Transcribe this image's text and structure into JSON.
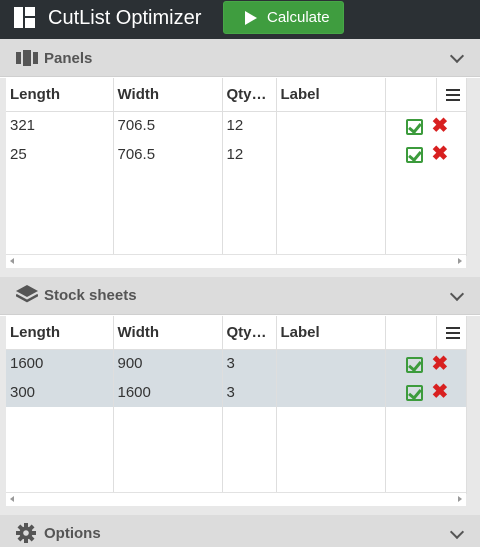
{
  "app": {
    "title": "CutList Optimizer",
    "calculate_label": "Calculate"
  },
  "colors": {
    "topbar": "#2b3034",
    "calculate": "#3f9d3f",
    "section_header": "#dcdcdc",
    "selected_row": "#d6dde2",
    "check": "#3c9b3c",
    "delete": "#d82020"
  },
  "panels": {
    "title": "Panels",
    "icon": "panels-icon",
    "columns": [
      "Length",
      "Width",
      "Qty…",
      "Label"
    ],
    "rows": [
      {
        "length": "321",
        "width": "706.5",
        "qty": "12",
        "label": ""
      },
      {
        "length": "25",
        "width": "706.5",
        "qty": "12",
        "label": ""
      }
    ]
  },
  "stock": {
    "title": "Stock sheets",
    "icon": "layers-icon",
    "columns": [
      "Length",
      "Width",
      "Qty…",
      "Label"
    ],
    "rows": [
      {
        "length": "1600",
        "width": "900",
        "qty": "3",
        "label": ""
      },
      {
        "length": "300",
        "width": "1600",
        "qty": "3",
        "label": ""
      }
    ]
  },
  "options": {
    "title": "Options",
    "icon": "gear-icon"
  }
}
